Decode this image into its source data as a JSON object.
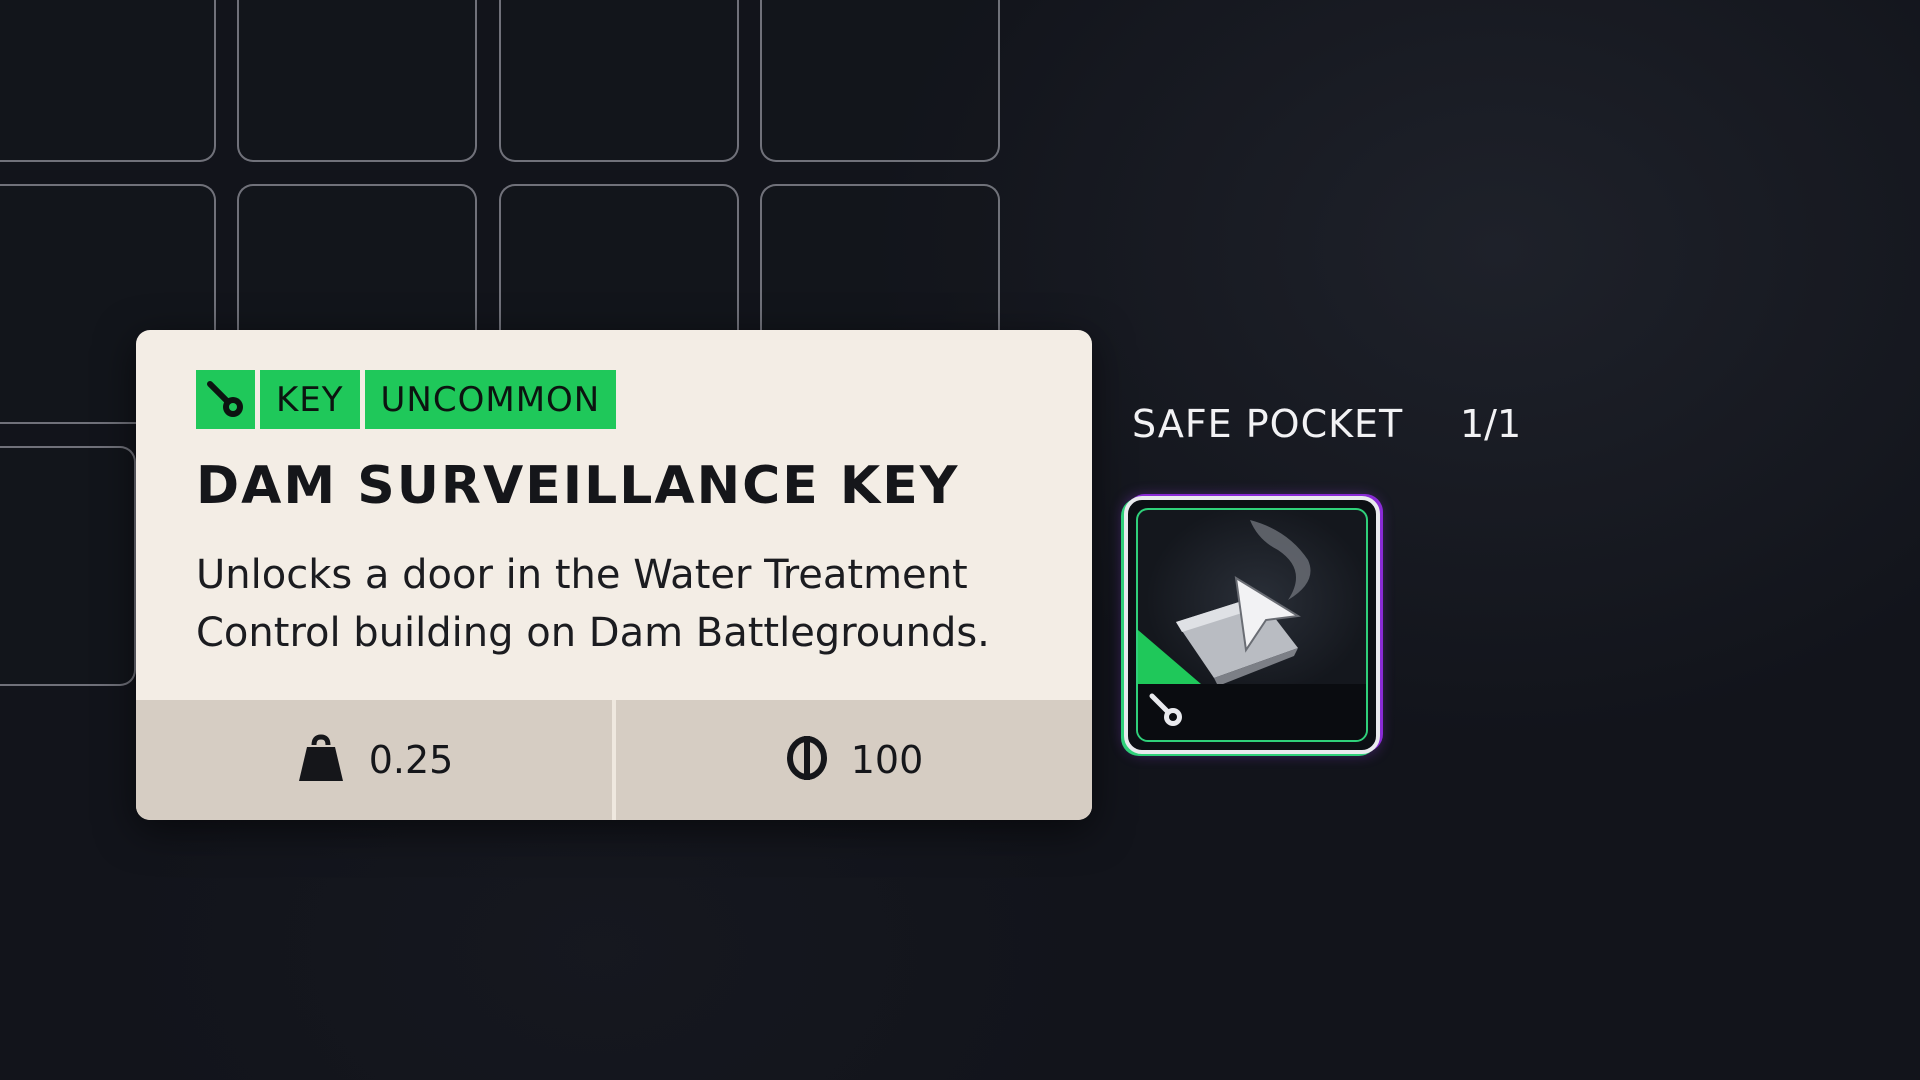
{
  "item": {
    "category_tag": "KEY",
    "rarity_tag": "UNCOMMON",
    "name": "DAM SURVEILLANCE KEY",
    "description": "Unlocks a door in the Water Treatment Control building on Dam Battlegrounds.",
    "weight": "0.25",
    "value": "100",
    "icons": {
      "category": "key-icon",
      "weight": "weight-icon",
      "value": "coin-icon"
    }
  },
  "safe_pocket": {
    "label": "SAFE POCKET",
    "count": "1/1"
  },
  "colors": {
    "rarity_green": "#1fc85a",
    "card_background": "#f3ede5",
    "stats_background": "#d6cdc3",
    "page_background": "#12141b",
    "highlight_purple": "#8a2bd6"
  }
}
